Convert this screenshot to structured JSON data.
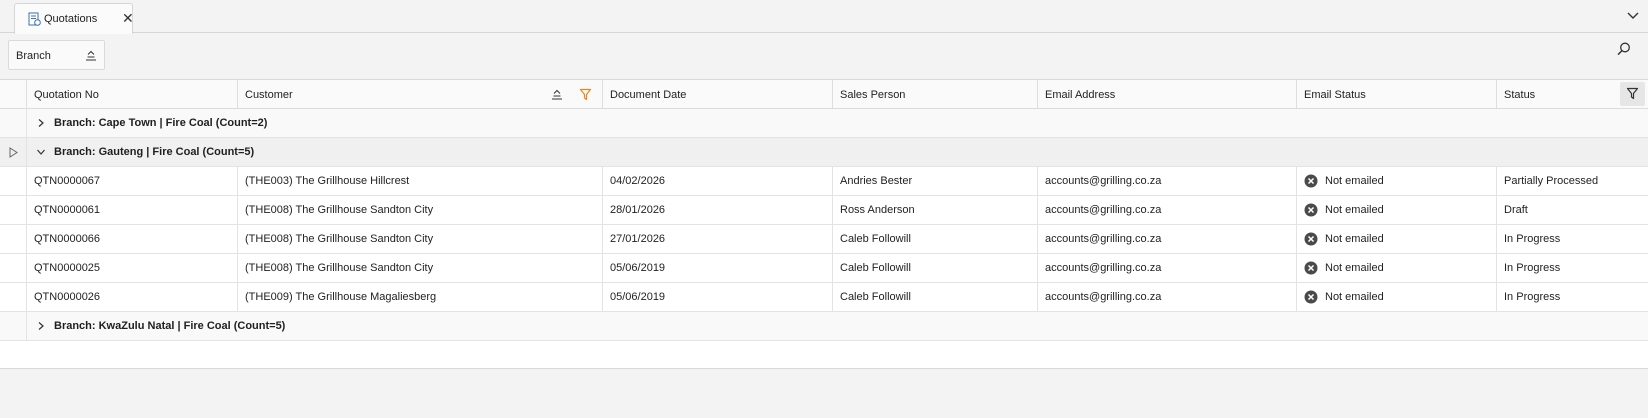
{
  "tab": {
    "label": "Quotations"
  },
  "group_panel": {
    "chip_label": "Branch"
  },
  "columns": [
    {
      "label": "Quotation No"
    },
    {
      "label": "Customer"
    },
    {
      "label": "Document Date"
    },
    {
      "label": "Sales Person"
    },
    {
      "label": "Email Address"
    },
    {
      "label": "Email Status"
    },
    {
      "label": "Status"
    }
  ],
  "groups": [
    {
      "label": "Branch: Cape Town | Fire Coal (Count=2)",
      "expanded": false
    },
    {
      "label": "Branch: Gauteng | Fire Coal (Count=5)",
      "expanded": true
    },
    {
      "label": "Branch: KwaZulu Natal | Fire Coal (Count=5)",
      "expanded": false
    }
  ],
  "rows": [
    {
      "quotation_no": "QTN0000067",
      "customer": "(THE003) The Grillhouse Hillcrest",
      "date": "04/02/2026",
      "sales_person": "Andries Bester",
      "email": "accounts@grilling.co.za",
      "email_status": "Not emailed",
      "status": "Partially Processed"
    },
    {
      "quotation_no": "QTN0000061",
      "customer": "(THE008) The Grillhouse Sandton City",
      "date": "28/01/2026",
      "sales_person": "Ross Anderson",
      "email": "accounts@grilling.co.za",
      "email_status": "Not emailed",
      "status": "Draft"
    },
    {
      "quotation_no": "QTN0000066",
      "customer": "(THE008) The Grillhouse Sandton City",
      "date": "27/01/2026",
      "sales_person": "Caleb Followill",
      "email": "accounts@grilling.co.za",
      "email_status": "Not emailed",
      "status": "In Progress"
    },
    {
      "quotation_no": "QTN0000025",
      "customer": "(THE008) The Grillhouse Sandton City",
      "date": "05/06/2019",
      "sales_person": "Caleb Followill",
      "email": "accounts@grilling.co.za",
      "email_status": "Not emailed",
      "status": "In Progress"
    },
    {
      "quotation_no": "QTN0000026",
      "customer": "(THE009) The Grillhouse Magaliesberg",
      "date": "05/06/2019",
      "sales_person": "Caleb Followill",
      "email": "accounts@grilling.co.za",
      "email_status": "Not emailed",
      "status": "In Progress"
    }
  ],
  "icons": {
    "tab_icon": "document-icon",
    "tab_close": "close-icon",
    "tabs_menu": "chevron-down-icon",
    "group_sort": "sort-ascending-icon",
    "search": "search-icon",
    "filter": "filter-icon",
    "email_status": "x-circle-icon"
  },
  "colors": {
    "filter_active": "#e8891f",
    "email_status_icon": "#4a4a4a"
  }
}
